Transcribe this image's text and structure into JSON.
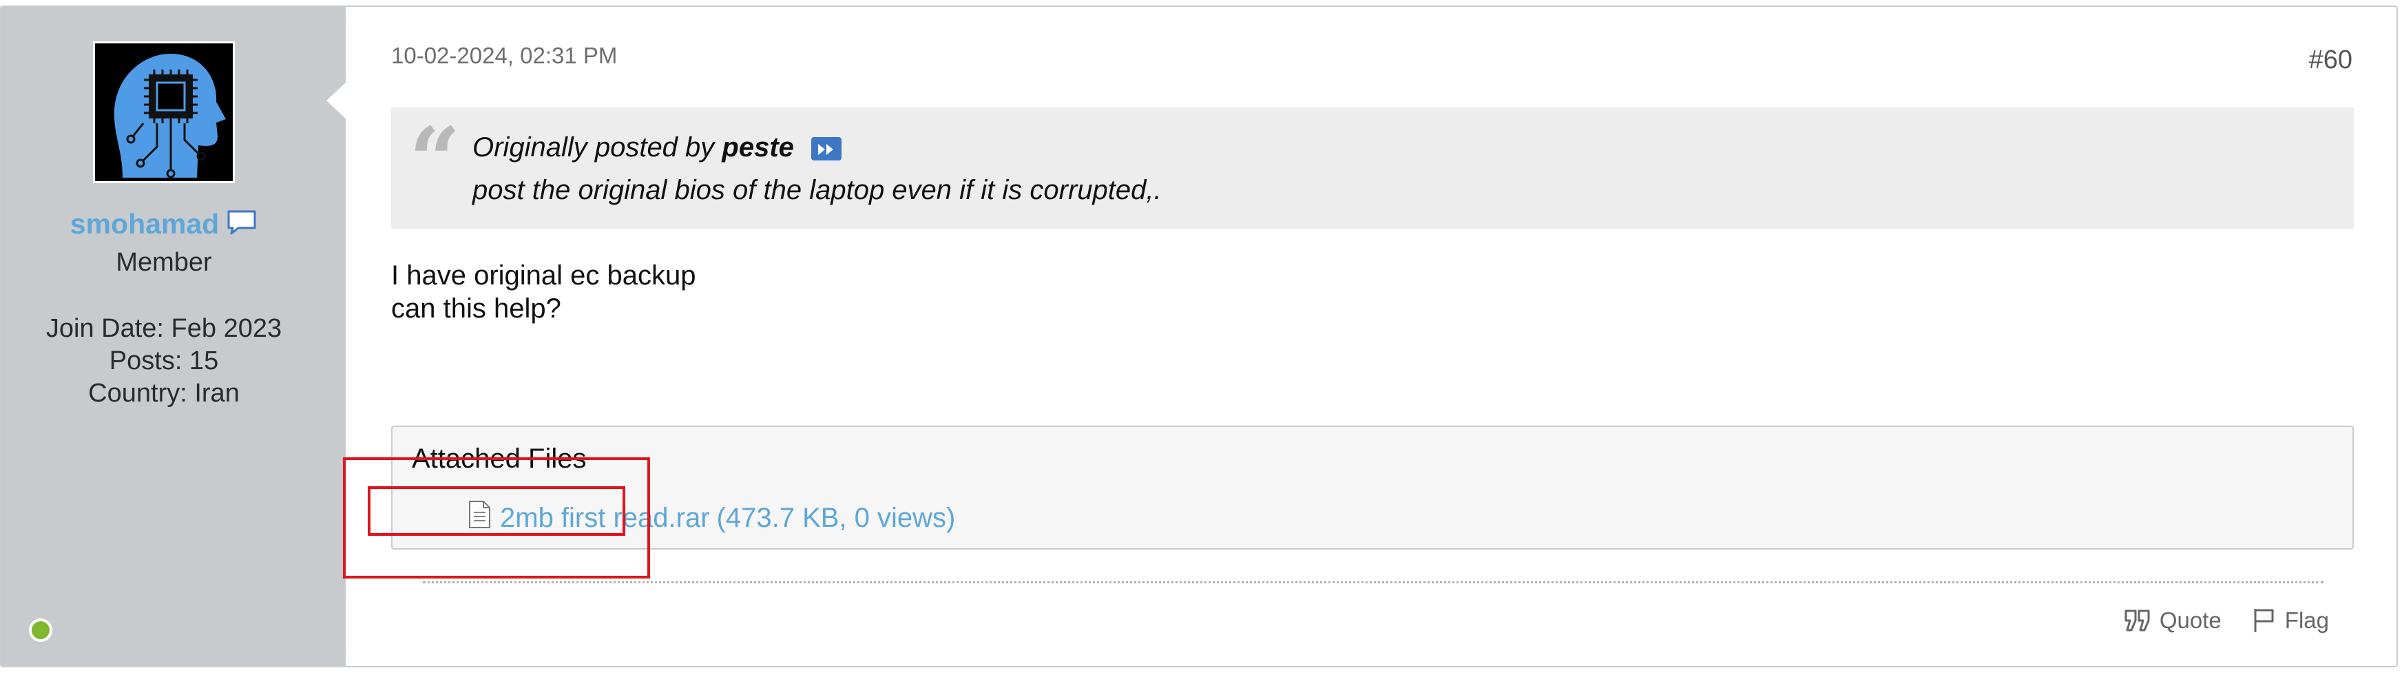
{
  "user": {
    "name": "smohamad",
    "title": "Member",
    "join_date": "Join Date: Feb 2023",
    "posts": "Posts: 15",
    "country": "Country: Iran",
    "status_color": "#7fb72e"
  },
  "post": {
    "date": "10-02-2024, 02:31 PM",
    "number": "#60",
    "quote": {
      "prefix": "Originally posted by",
      "author": "peste",
      "text": "post the original bios of the laptop even if it is corrupted,."
    },
    "message_lines": [
      "I have original ec backup",
      "can this help?"
    ],
    "attachments": {
      "title": "Attached Files",
      "files": [
        {
          "name": "2mb first read.rar",
          "meta": "(473.7 KB, 0 views)",
          "icon": "file-icon"
        }
      ]
    },
    "actions": {
      "quote_label": "Quote",
      "flag_label": "Flag"
    }
  },
  "colors": {
    "accent": "#5ea7d8",
    "highlight": "#e0141c",
    "sidebar": "#c8cbce"
  }
}
